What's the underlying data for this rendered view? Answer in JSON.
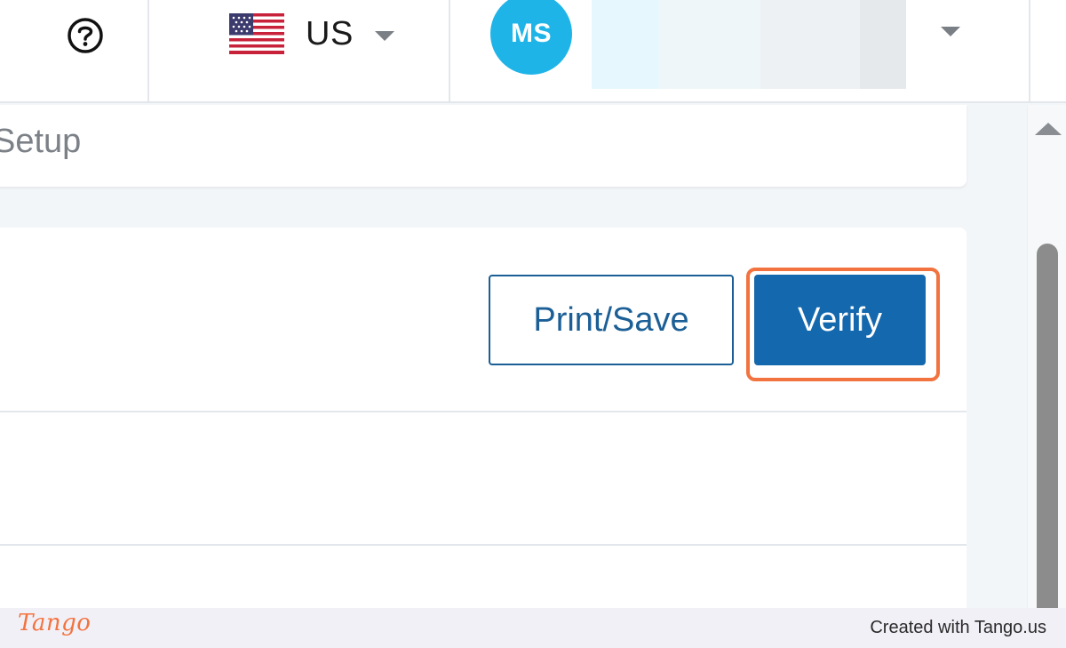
{
  "header": {
    "help_icon": "question-circle-icon",
    "locale": {
      "flag_icon": "us-flag-icon",
      "label": "US"
    },
    "user": {
      "initials": "MS",
      "avatar_color": "#1fb4e8"
    }
  },
  "setup": {
    "title": "Setup"
  },
  "actions": {
    "print_label": "Print/Save",
    "verify_label": "Verify"
  },
  "colors": {
    "primary": "#1468ad",
    "highlight": "#f2733f"
  },
  "footer": {
    "logo": "Tango",
    "credit": "Created with Tango.us"
  }
}
